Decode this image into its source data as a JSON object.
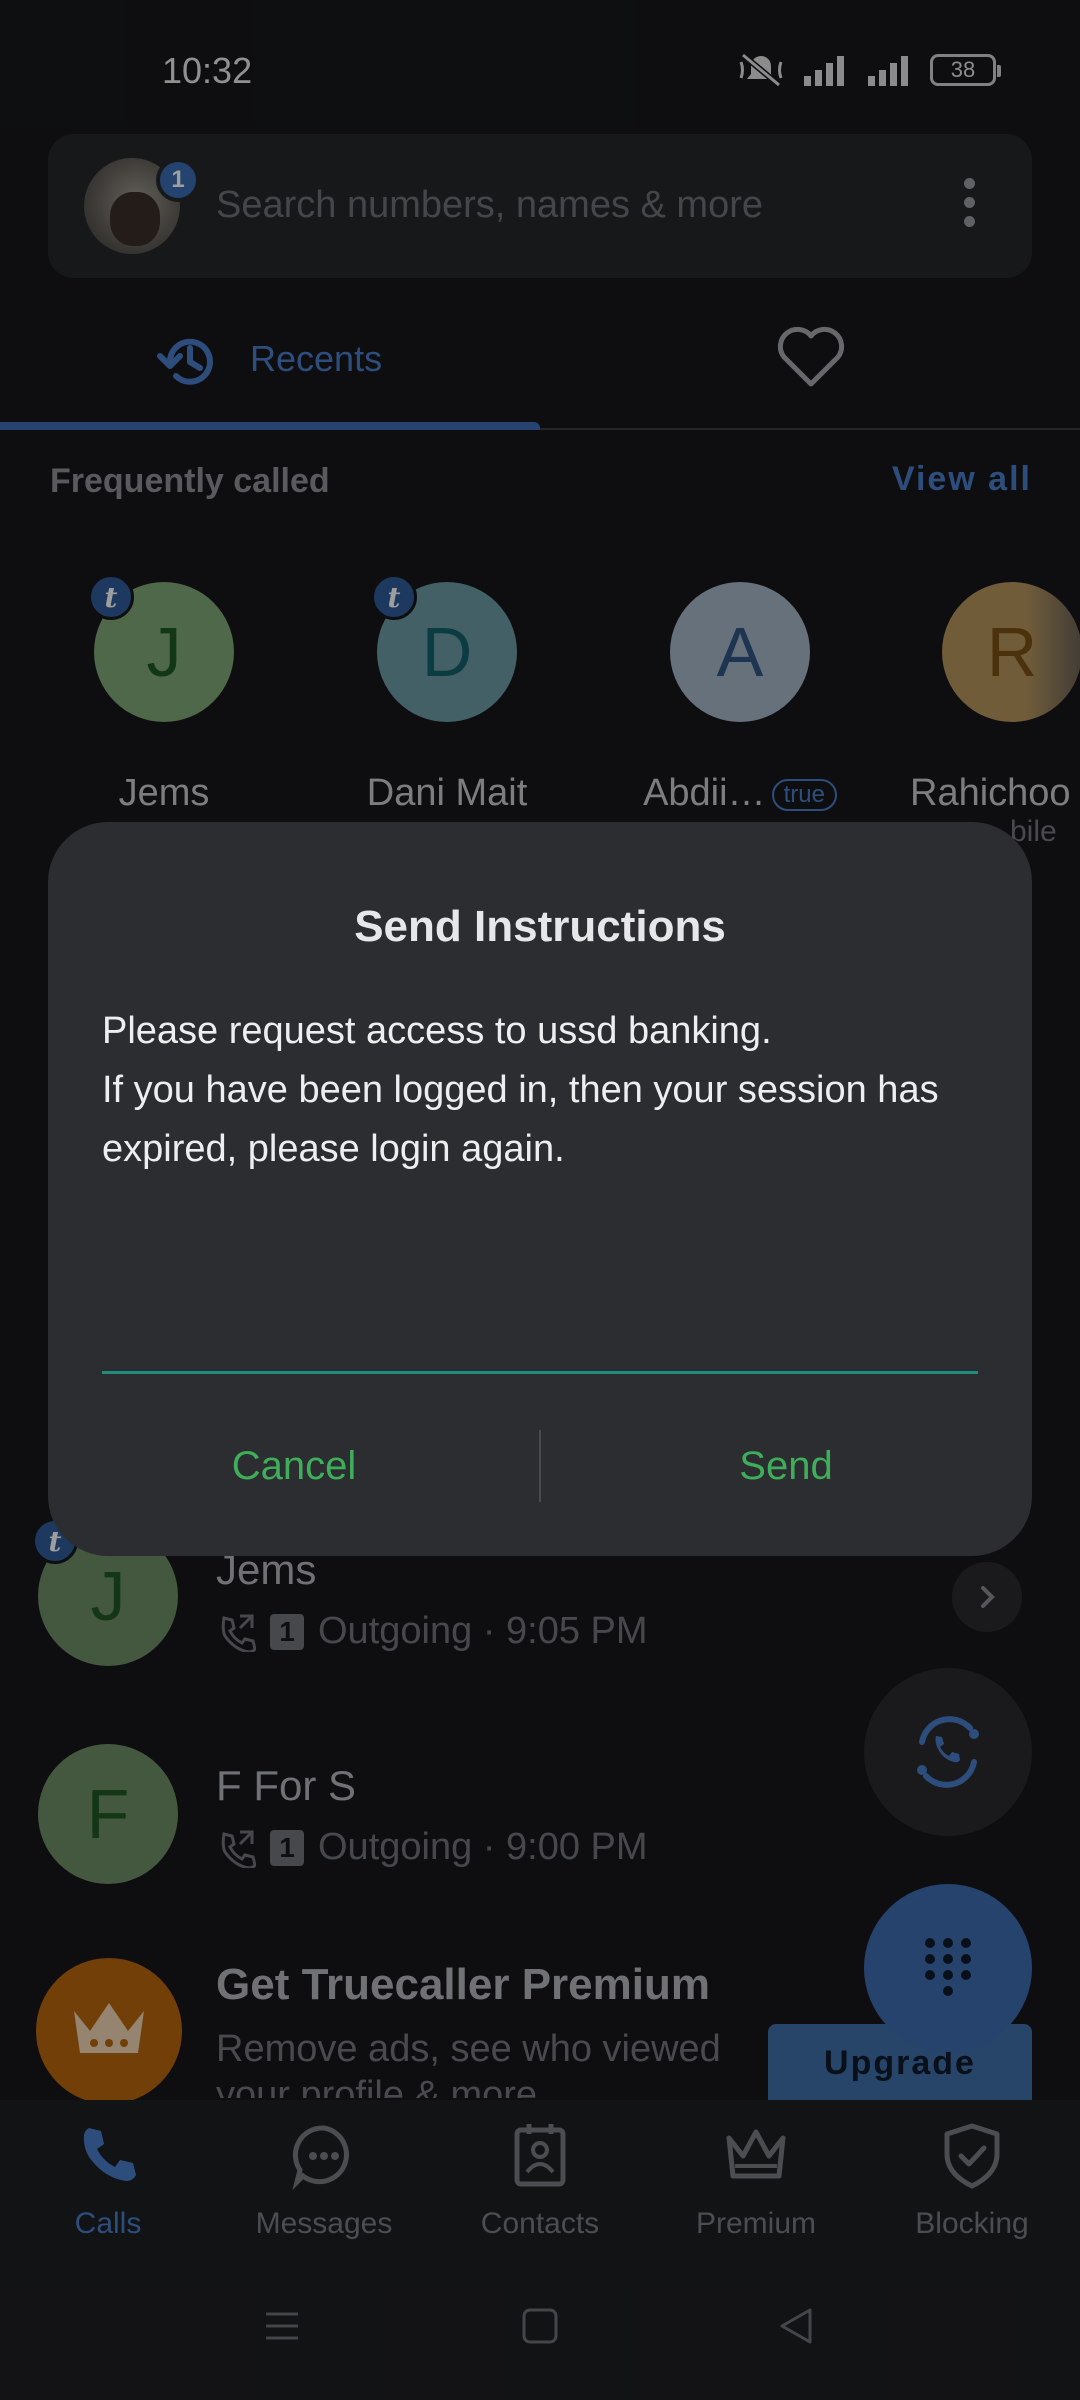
{
  "status_bar": {
    "time": "10:32",
    "battery": "38",
    "icons": [
      "mute-icon",
      "signal-icon",
      "signal-icon"
    ]
  },
  "search": {
    "placeholder": "Search numbers, names & more",
    "badge_count": "1"
  },
  "tabs": {
    "recents_label": "Recents",
    "favorites_icon": "heart-icon"
  },
  "frequently_called": {
    "title": "Frequently called",
    "view_all": "View all",
    "items": [
      {
        "initial": "J",
        "name": "Jems",
        "badge": "t",
        "color": "#7ea877"
      },
      {
        "initial": "D",
        "name": "Dani Mait",
        "badge": "t",
        "color": "#6b9ca4"
      },
      {
        "initial": "A",
        "name": "Abdii…",
        "pill": "true",
        "color": "#a7b7c9"
      },
      {
        "initial": "R",
        "name": "Rahichoo",
        "sub": "bile",
        "color": "#b6955e"
      }
    ]
  },
  "calls": [
    {
      "initial": "J",
      "name": "Jems",
      "badge": "t",
      "sim": "1",
      "meta": "Outgoing · 9:05 PM"
    },
    {
      "initial": "F",
      "name": "F For S",
      "sim": "1",
      "meta": "Outgoing · 9:00 PM"
    }
  ],
  "promo": {
    "title": "Get Truecaller Premium",
    "subtitle": "Remove ads, see who viewed your profile & more",
    "button": "Upgrade"
  },
  "dialog": {
    "title": "Send Instructions",
    "message": "Please request access to ussd banking.\nIf you have been logged in, then your session has expired, please login again.",
    "input_value": "",
    "cancel": "Cancel",
    "send": "Send"
  },
  "bottom_nav": [
    {
      "label": "Calls",
      "icon": "phone-icon",
      "active": true
    },
    {
      "label": "Messages",
      "icon": "chat-icon"
    },
    {
      "label": "Contacts",
      "icon": "contact-card-icon"
    },
    {
      "label": "Premium",
      "icon": "crown-icon"
    },
    {
      "label": "Blocking",
      "icon": "shield-check-icon"
    }
  ],
  "colors": {
    "accent": "#4a7ec8",
    "dialog_button": "#3fae5a",
    "input_line": "#1f8d7c",
    "premium": "#b8660f"
  }
}
